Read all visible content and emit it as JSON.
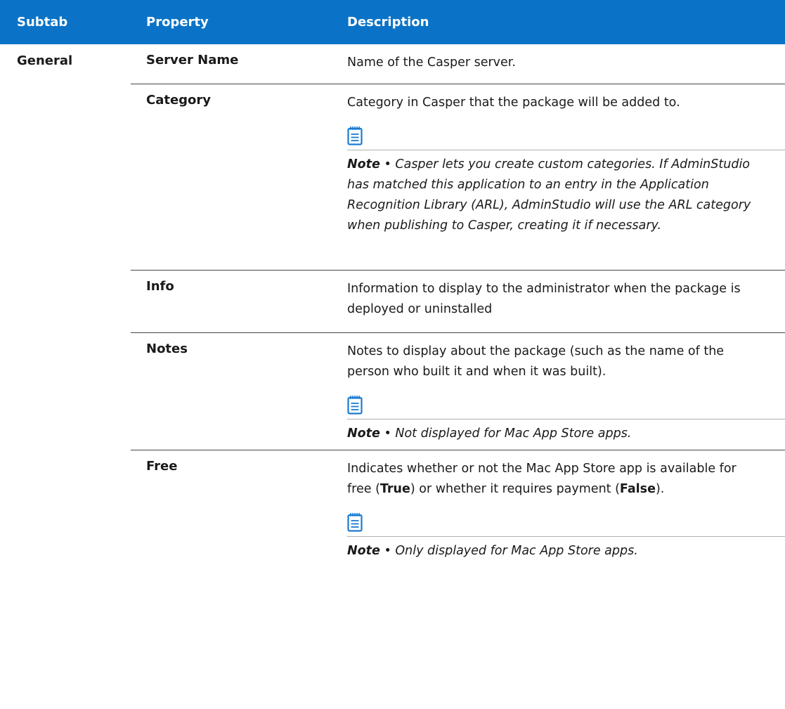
{
  "header": {
    "subtab": "Subtab",
    "property": "Property",
    "description": "Description"
  },
  "subtab_value": "General",
  "rows": [
    {
      "property": "Server Name",
      "description": "Name of the Casper server."
    },
    {
      "property": "Category",
      "description": "Category in Casper that the package will be added to.",
      "note_label": "Note",
      "note_text": "• Casper lets you create custom categories. If AdminStudio has matched this application to an entry in the Application Recognition Library (ARL), AdminStudio will use the ARL category when publishing to Casper, creating it if necessary."
    },
    {
      "property": "Info",
      "description": "Information to display to the administrator when the package is deployed or uninstalled"
    },
    {
      "property": "Notes",
      "description": "Notes to display about the package (such as the name of the person who built it and when it was built).",
      "note_label": "Note",
      "note_text": "• Not displayed for Mac App Store apps."
    },
    {
      "property": "Free",
      "description_part1": "Indicates whether or not the Mac App Store app is available for free (",
      "description_true": "True",
      "description_part2": ") or whether it requires payment (",
      "description_false": "False",
      "description_part3": ").",
      "note_label": "Note",
      "note_text": "• Only displayed for Mac App Store apps."
    }
  ],
  "icons": {
    "note": "notepad-icon"
  },
  "colors": {
    "header_bg": "#0a73c7",
    "icon": "#1a7bd1"
  }
}
